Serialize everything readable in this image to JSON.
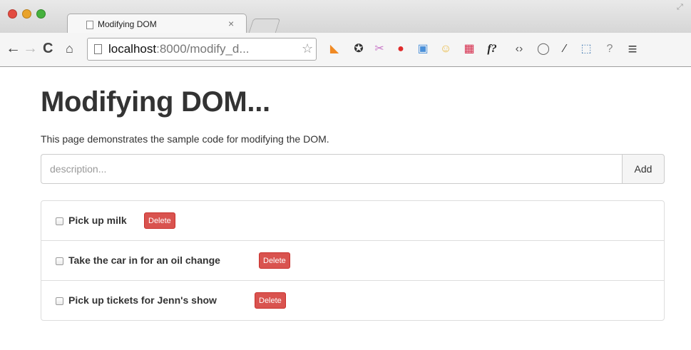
{
  "browser": {
    "tab_title": "Modifying DOM",
    "tab_close": "×",
    "url_host": "localhost",
    "url_rest": ":8000/modify_d...",
    "star": "☆",
    "nav": {
      "back": "←",
      "forward": "→",
      "reload": "C",
      "home": "⌂"
    },
    "extensions": [
      {
        "name": "rss-icon",
        "glyph": "◣",
        "color": "#f08a24"
      },
      {
        "name": "sync-icon",
        "glyph": "✪",
        "color": "#333333"
      },
      {
        "name": "tools-icon",
        "glyph": "✂",
        "color": "#c879c9"
      },
      {
        "name": "stop-icon",
        "glyph": "●",
        "color": "#e02b2b"
      },
      {
        "name": "window-icon",
        "glyph": "▣",
        "color": "#4a90d9"
      },
      {
        "name": "cookie-icon",
        "glyph": "☺",
        "color": "#e9b940"
      },
      {
        "name": "grid-icon",
        "glyph": "▦",
        "color": "#d52a4a"
      },
      {
        "name": "font-icon",
        "glyph": "f?",
        "color": "#222222"
      },
      {
        "name": "code-icon",
        "glyph": "‹›",
        "color": "#555555"
      },
      {
        "name": "circle-icon",
        "glyph": "◯",
        "color": "#666666"
      },
      {
        "name": "eyedropper-icon",
        "glyph": "⁄",
        "color": "#333333"
      },
      {
        "name": "screenshot-icon",
        "glyph": "⬚",
        "color": "#4a7fb5"
      },
      {
        "name": "help-icon",
        "glyph": "?",
        "color": "#888888"
      },
      {
        "name": "menu-icon",
        "glyph": "≡",
        "color": "#444444"
      }
    ]
  },
  "page": {
    "title": "Modifying DOM...",
    "lede": "This page demonstrates the sample code for modifying the DOM.",
    "input": {
      "placeholder": "description...",
      "value": ""
    },
    "add_label": "Add",
    "delete_label": "Delete",
    "items": [
      {
        "label": "Pick up milk",
        "checked": false
      },
      {
        "label": "Take the car in for an oil change",
        "checked": false
      },
      {
        "label": "Pick up tickets for Jenn's show",
        "checked": false
      }
    ]
  }
}
